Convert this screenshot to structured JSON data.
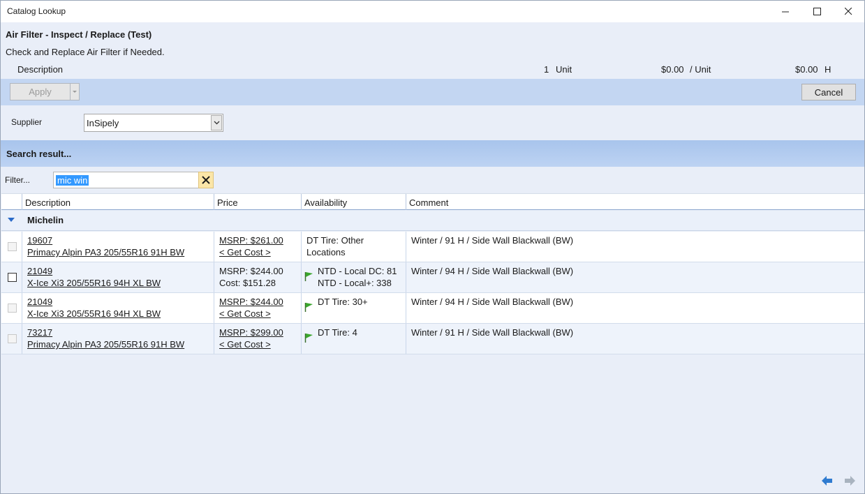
{
  "window": {
    "title": "Catalog Lookup"
  },
  "operation": {
    "title": "Air Filter - Inspect / Replace (Test)",
    "subtitle": "Check and Replace Air Filter if Needed.",
    "description_label": "Description",
    "quantity": "1",
    "quantity_unit": "Unit",
    "unit_price": "$0.00",
    "unit_price_suffix": "/ Unit",
    "labor_price": "$0.00",
    "labor_unit": "H"
  },
  "toolbar": {
    "apply_label": "Apply",
    "cancel_label": "Cancel"
  },
  "supplier": {
    "label": "Supplier",
    "value": "InSipely"
  },
  "search": {
    "title": "Search result...",
    "filter_label": "Filter...",
    "filter_value": "mic win"
  },
  "grid": {
    "columns": [
      "Description",
      "Price",
      "Availability",
      "Comment"
    ],
    "group": "Michelin",
    "rows": [
      {
        "part_no": "19607",
        "name": "Primacy Alpin PA3 205/55R16 91H BW",
        "price_line1": "MSRP: $261.00",
        "price_line2": "< Get Cost >",
        "avail_line1": "DT Tire: Other",
        "avail_line2": "Locations",
        "comment": "Winter / 91 H / Side Wall Blackwall (BW)"
      },
      {
        "part_no": "21049",
        "name": "X-Ice Xi3 205/55R16 94H XL BW",
        "price_line1": "MSRP: $244.00",
        "price_line2": "Cost: $151.28",
        "avail_line1": "NTD - Local DC: 81",
        "avail_line2": "NTD - Local+: 338",
        "comment": "Winter / 94 H / Side Wall Blackwall (BW)"
      },
      {
        "part_no": "21049",
        "name": "X-Ice Xi3 205/55R16 94H XL BW",
        "price_line1": "MSRP: $244.00",
        "price_line2": "< Get Cost >",
        "avail_line1": "DT Tire: 30+",
        "avail_line2": "",
        "comment": "Winter / 94 H / Side Wall Blackwall (BW)"
      },
      {
        "part_no": "73217",
        "name": "Primacy Alpin PA3 205/55R16 91H BW",
        "price_line1": "MSRP: $299.00",
        "price_line2": "< Get Cost >",
        "avail_line1": "DT Tire: 4",
        "avail_line2": "",
        "comment": "Winter / 91 H / Side Wall Blackwall (BW)"
      }
    ]
  },
  "icons": {
    "flag": "green-flag-icon",
    "prev": "arrow-left-icon",
    "next": "arrow-right-icon"
  },
  "colors": {
    "toolbar_bg": "#c3d6f2",
    "search_header_bg": "#a8c4ec",
    "flag_green": "#3aa52c",
    "nav_blue": "#2f7bd0"
  }
}
